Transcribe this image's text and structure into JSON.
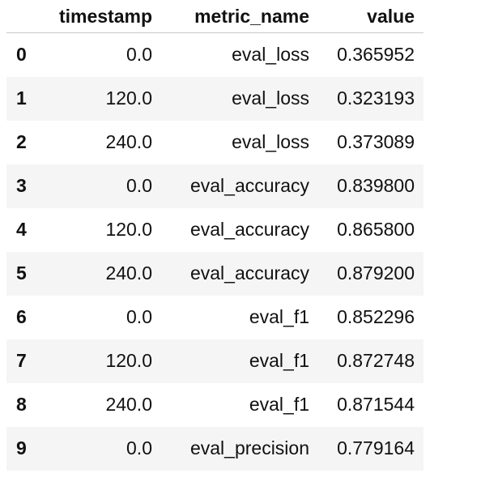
{
  "table": {
    "headers": {
      "index": "",
      "timestamp": "timestamp",
      "metric_name": "metric_name",
      "value": "value"
    },
    "rows": [
      {
        "index": "0",
        "timestamp": "0.0",
        "metric_name": "eval_loss",
        "value": "0.365952"
      },
      {
        "index": "1",
        "timestamp": "120.0",
        "metric_name": "eval_loss",
        "value": "0.323193"
      },
      {
        "index": "2",
        "timestamp": "240.0",
        "metric_name": "eval_loss",
        "value": "0.373089"
      },
      {
        "index": "3",
        "timestamp": "0.0",
        "metric_name": "eval_accuracy",
        "value": "0.839800"
      },
      {
        "index": "4",
        "timestamp": "120.0",
        "metric_name": "eval_accuracy",
        "value": "0.865800"
      },
      {
        "index": "5",
        "timestamp": "240.0",
        "metric_name": "eval_accuracy",
        "value": "0.879200"
      },
      {
        "index": "6",
        "timestamp": "0.0",
        "metric_name": "eval_f1",
        "value": "0.852296"
      },
      {
        "index": "7",
        "timestamp": "120.0",
        "metric_name": "eval_f1",
        "value": "0.872748"
      },
      {
        "index": "8",
        "timestamp": "240.0",
        "metric_name": "eval_f1",
        "value": "0.871544"
      },
      {
        "index": "9",
        "timestamp": "0.0",
        "metric_name": "eval_precision",
        "value": "0.779164"
      }
    ]
  }
}
